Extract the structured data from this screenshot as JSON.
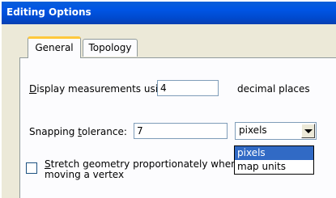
{
  "window": {
    "title": "Editing Options"
  },
  "tabs": [
    {
      "label": "General",
      "active": true
    },
    {
      "label": "Topology",
      "active": false
    }
  ],
  "general": {
    "display_label_pre": "",
    "display_mnemonic": "D",
    "display_label_rest": "isplay measurements using",
    "decimal_value": "4",
    "decimal_suffix": "decimal places",
    "snap_label_pre": "Snapping ",
    "snap_mnemonic": "t",
    "snap_label_rest": "olerance:",
    "snap_value": "7",
    "units_selected": "pixels",
    "units_options": [
      "pixels",
      "map units"
    ],
    "stretch_mnemonic": "S",
    "stretch_line1_rest": "tretch geometry proportionately when",
    "stretch_line2": "moving a vertex",
    "stretch_checked": false
  }
}
